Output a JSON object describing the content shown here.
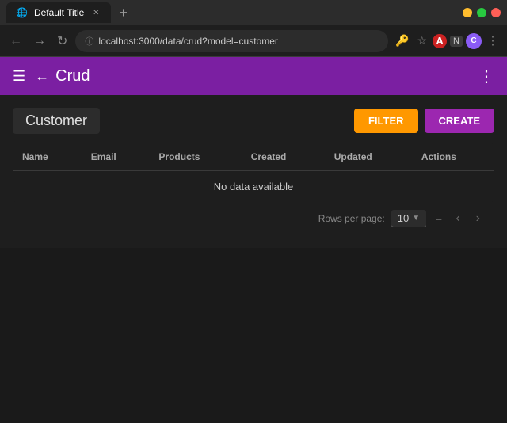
{
  "browser": {
    "tab": {
      "title": "Default Title",
      "favicon": "🌐"
    },
    "address": "localhost:3000/data/crud?model=customer",
    "window_controls": {
      "minimize": "−",
      "maximize": "□",
      "close": "✕"
    },
    "nav": {
      "back": "←",
      "forward": "→",
      "refresh": "↻"
    },
    "toolbar_icons": {
      "lock": "🔑",
      "star": "☆",
      "extension1": "🔴",
      "extension2": "N",
      "avatar": "C",
      "menu": "⋮"
    }
  },
  "app": {
    "title": "Crud",
    "menu_icon": "☰",
    "back_icon": "←",
    "more_icon": "⋮"
  },
  "page": {
    "title": "Customer",
    "filter_button": "FILTER",
    "create_button": "CReATE"
  },
  "table": {
    "columns": [
      "Name",
      "Email",
      "Products",
      "Created",
      "Updated",
      "Actions"
    ],
    "empty_message": "No data available"
  },
  "pagination": {
    "rows_per_page_label": "Rows per page:",
    "rows_per_page_value": "10",
    "page_info": "–",
    "prev_icon": "‹",
    "next_icon": "›"
  }
}
